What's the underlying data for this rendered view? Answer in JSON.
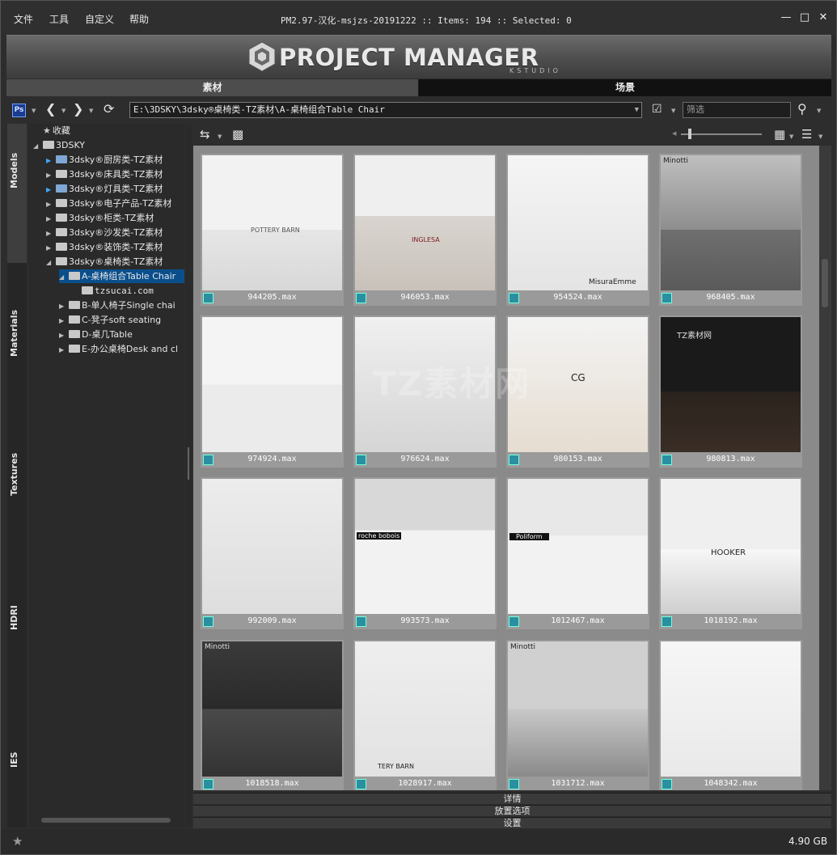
{
  "menu": [
    "文件",
    "工具",
    "自定义",
    "帮助"
  ],
  "window": {
    "title": "PM2.97-汉化-msjzs-20191222  :: Items: 194  :: Selected: 0"
  },
  "banner": {
    "title": "PROJECT MANAGER",
    "subtitle": "KSTUDIO"
  },
  "tabs": [
    "素材",
    "场景"
  ],
  "toolbar": {
    "ps_label": "Ps",
    "path": "E:\\3DSKY\\3dsky®桌椅类-TZ素材\\A-桌椅组合Table Chair",
    "filter_placeholder": "筛选"
  },
  "side_tabs": [
    "Models",
    "Materials",
    "Textures",
    "HDRI",
    "IES"
  ],
  "tree": [
    {
      "label": "收藏",
      "level": 0,
      "type": "star"
    },
    {
      "label": "3DSKY",
      "level": 0,
      "type": "folder",
      "expanded": true
    },
    {
      "label": "3dsky®厨房类-TZ素材",
      "level": 1,
      "type": "folder"
    },
    {
      "label": "3dsky®床具类-TZ素材",
      "level": 1,
      "type": "folder"
    },
    {
      "label": "3dsky®灯具类-TZ素材",
      "level": 1,
      "type": "folder"
    },
    {
      "label": "3dsky®电子产品-TZ素材",
      "level": 1,
      "type": "folder"
    },
    {
      "label": "3dsky®柜类-TZ素材",
      "level": 1,
      "type": "folder"
    },
    {
      "label": "3dsky®沙发类-TZ素材",
      "level": 1,
      "type": "folder"
    },
    {
      "label": "3dsky®装饰类-TZ素材",
      "level": 1,
      "type": "folder"
    },
    {
      "label": "3dsky®桌椅类-TZ素材",
      "level": 1,
      "type": "folder",
      "expanded": true
    },
    {
      "label": "A-桌椅组合Table Chair",
      "level": 2,
      "type": "folder",
      "selected": true
    },
    {
      "label": "tzsucai.com",
      "level": 3,
      "type": "folder"
    },
    {
      "label": "B-单人椅子Single chai",
      "level": 2,
      "type": "folder"
    },
    {
      "label": "C-凳子soft seating",
      "level": 2,
      "type": "folder"
    },
    {
      "label": "D-桌几Table",
      "level": 2,
      "type": "folder"
    },
    {
      "label": "E-办公桌椅Desk and cl",
      "level": 2,
      "type": "folder"
    }
  ],
  "thumbnails": [
    {
      "file": "944205.max",
      "brand": "POTTERY BARN"
    },
    {
      "file": "946053.max",
      "brand": "INGLESA"
    },
    {
      "file": "954524.max",
      "brand": "MisuraEmme"
    },
    {
      "file": "968405.max",
      "brand": "Minotti"
    },
    {
      "file": "974924.max",
      "brand": ""
    },
    {
      "file": "976624.max",
      "brand": ""
    },
    {
      "file": "980153.max",
      "brand": "CG"
    },
    {
      "file": "980813.max",
      "brand": "TZ素材网"
    },
    {
      "file": "992009.max",
      "brand": ""
    },
    {
      "file": "993573.max",
      "brand": "roche bobois"
    },
    {
      "file": "1012467.max",
      "brand": "Poliform"
    },
    {
      "file": "1018192.max",
      "brand": "HOOKER"
    },
    {
      "file": "1018518.max",
      "brand": "Minotti"
    },
    {
      "file": "1028917.max",
      "brand": "TERY BARN"
    },
    {
      "file": "1031712.max",
      "brand": "Minotti"
    },
    {
      "file": "1048342.max",
      "brand": ""
    }
  ],
  "watermark": "TZ素材网",
  "panels": [
    "详情",
    "放置选项",
    "设置"
  ],
  "status": {
    "disk": "4.90 GB"
  },
  "colors": {
    "selection": "#0a4f8c",
    "max_badge": "#2a8fa0",
    "ps_badge": "#1b3c8f"
  }
}
